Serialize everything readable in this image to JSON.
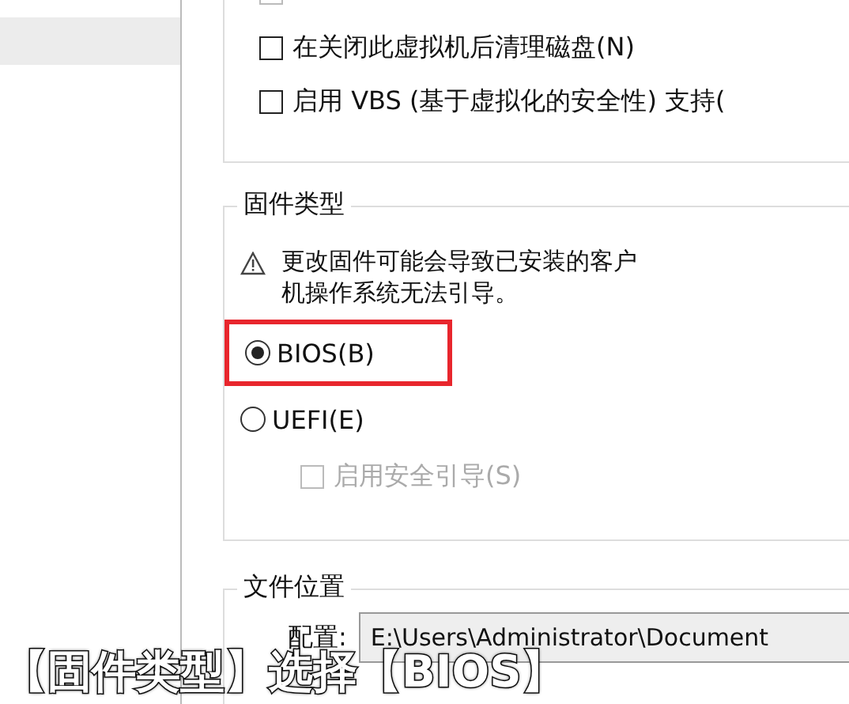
{
  "sidebar": {
    "items": [
      {
        "selected": true
      }
    ]
  },
  "options_group": {
    "checkboxes": [
      {
        "label": "在关闭此虚拟机后清理磁盘(N)",
        "checked": false,
        "disabled": false
      },
      {
        "label": "启用 VBS (基于虚拟化的安全性) 支持(",
        "checked": false,
        "disabled": false
      }
    ]
  },
  "firmware_group": {
    "title": "固件类型",
    "warning": "更改固件可能会导致已安装的客户机操作系统无法引导。",
    "radios": [
      {
        "label": "BIOS(B)",
        "selected": true,
        "highlighted": true
      },
      {
        "label": "UEFI(E)",
        "selected": false,
        "highlighted": false
      }
    ],
    "secure_boot": {
      "label": "启用安全引导(S)",
      "checked": false,
      "disabled": true
    }
  },
  "file_group": {
    "title": "文件位置",
    "config_label": "配置:",
    "config_value": "E:\\Users\\Administrator\\Document"
  },
  "caption": "【固件类型】选择【BIOS】"
}
